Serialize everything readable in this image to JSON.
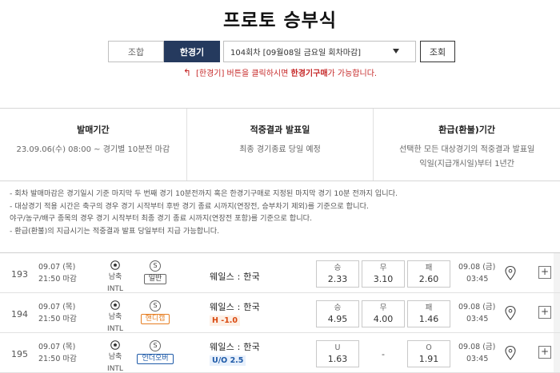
{
  "page": {
    "title": "프로토 승부식"
  },
  "controls": {
    "combo_label": "조합",
    "single_label": "한경기",
    "round_select_value": "104회차 [09월08일 금요일 회차마감]",
    "lookup_label": "조회"
  },
  "notice": {
    "prefix": "[한경기] 버튼을 클릭하시면",
    "highlight": "한경기구매",
    "suffix": "가 가능합니다."
  },
  "info": [
    {
      "title": "발매기간",
      "lines": [
        "23.09.06(수) 08:00 ~ 경기별 10분전 마감"
      ]
    },
    {
      "title": "적중결과 발표일",
      "lines": [
        "최종 경기종료 당일 예정"
      ]
    },
    {
      "title": "환급(환불)기간",
      "lines": [
        "선택한 모든 대상경기의 적중결과 발표일",
        "익일(지급개시일)부터 1년간"
      ]
    }
  ],
  "rules": [
    "- 회차 발매마감은 경기일시 기준 마지막 두 번째 경기 10분전까지 혹은 한경기구매로 지정된 마지막 경기 10분 전까지 입니다.",
    "- 대상경기 적용 시간은 축구의 경우 경기 시작부터 후반 경기 종료 시까지(연장전, 승부차기 제외)를 기준으로 합니다.",
    "  야구/농구/배구 종목의 경우 경기 시작부터 최종 경기 종료 시까지(연장전 포함)를 기준으로 합니다.",
    "- 환급(환불)의 지급시기는 적중결과 발표 당일부터 지급 가능합니다."
  ],
  "games": [
    {
      "no": "193",
      "date": "09.07 (목)",
      "time": "21:50 마감",
      "sport": "남축INTL",
      "type_symbol": "S",
      "type": "일반",
      "type_style": "normal",
      "match": "웨일스 : 한국",
      "sub": "",
      "sub_style": "",
      "odds": [
        {
          "label": "승",
          "value": "2.33"
        },
        {
          "label": "무",
          "value": "3.10"
        },
        {
          "label": "패",
          "value": "2.60"
        }
      ],
      "close_date": "09.08 (금)",
      "close_time": "03:45"
    },
    {
      "no": "194",
      "date": "09.07 (목)",
      "time": "21:50 마감",
      "sport": "남축INTL",
      "type_symbol": "S",
      "type": "핸디캡",
      "type_style": "handi",
      "match": "웨일스 : 한국",
      "sub": "H -1.0",
      "sub_style": "handi",
      "odds": [
        {
          "label": "승",
          "value": "4.95"
        },
        {
          "label": "무",
          "value": "4.00"
        },
        {
          "label": "패",
          "value": "1.46"
        }
      ],
      "close_date": "09.08 (금)",
      "close_time": "03:45"
    },
    {
      "no": "195",
      "date": "09.07 (목)",
      "time": "21:50 마감",
      "sport": "남축INTL",
      "type_symbol": "S",
      "type": "언더오버",
      "type_style": "uo",
      "match": "웨일스 : 한국",
      "sub": "U/O 2.5",
      "sub_style": "uo",
      "odds": [
        {
          "label": "U",
          "value": "1.63"
        },
        {
          "label": "",
          "value": "-"
        },
        {
          "label": "O",
          "value": "1.91"
        }
      ],
      "close_date": "09.08 (금)",
      "close_time": "03:45"
    }
  ],
  "icons": {
    "sport": "soccer-ball-icon",
    "location": "map-pin-icon",
    "expand": "plus-icon",
    "notice": "return-arrow-icon",
    "dropdown": "caret-down-icon"
  },
  "colors": {
    "primary": "#253a5e",
    "notice_red": "#c62828",
    "handicap_orange": "#e67e22",
    "underover_blue": "#1e5aa8"
  }
}
